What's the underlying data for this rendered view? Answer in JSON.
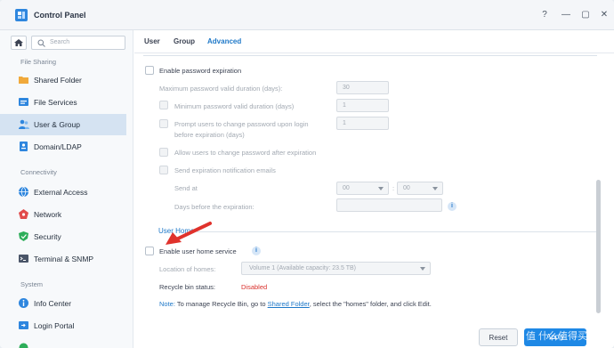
{
  "window": {
    "title": "Control Panel"
  },
  "sidebar": {
    "search_placeholder": "Search",
    "sections": [
      "File Sharing",
      "Connectivity",
      "System"
    ],
    "items": [
      {
        "label": "Shared Folder",
        "icon": "shared-folder-icon"
      },
      {
        "label": "File Services",
        "icon": "file-services-icon"
      },
      {
        "label": "User & Group",
        "icon": "user-group-icon",
        "active": true
      },
      {
        "label": "Domain/LDAP",
        "icon": "domain-icon"
      },
      {
        "label": "External Access",
        "icon": "external-access-icon"
      },
      {
        "label": "Network",
        "icon": "network-icon"
      },
      {
        "label": "Security",
        "icon": "security-icon"
      },
      {
        "label": "Terminal & SNMP",
        "icon": "terminal-icon"
      },
      {
        "label": "Info Center",
        "icon": "info-center-icon"
      },
      {
        "label": "Login Portal",
        "icon": "login-portal-icon"
      }
    ]
  },
  "tabs": [
    {
      "label": "User"
    },
    {
      "label": "Group"
    },
    {
      "label": "Advanced",
      "active": true
    }
  ],
  "password_expiration": {
    "enable_label": "Enable password expiration",
    "max_valid_label": "Maximum password valid duration (days):",
    "max_valid_value": "30",
    "min_valid_label": "Minimum password valid duration (days)",
    "min_valid_value": "1",
    "prompt_label_1": "Prompt users to change password upon login",
    "prompt_label_2": "before expiration (days)",
    "prompt_value": "1",
    "allow_change_label": "Allow users to change password after expiration",
    "send_notification_label": "Send expiration notification emails",
    "send_at_label": "Send at",
    "send_at_hour": "00",
    "send_at_minute": "00",
    "time_separator": ":",
    "days_before_label": "Days before the expiration:"
  },
  "user_home": {
    "section_title": "User Home",
    "enable_label": "Enable user home service",
    "location_label": "Location of homes:",
    "location_value": "Volume 1 (Available capacity:  23.5 TB)",
    "recycle_label": "Recycle bin status:",
    "recycle_status": "Disabled",
    "note_prefix": "Note:",
    "note_text_1": "To manage Recycle Bin, go to",
    "note_link": "Shared Folder",
    "note_text_2": ", select the \"homes\" folder, and click Edit."
  },
  "footer": {
    "reset_label": "Reset",
    "apply_label": "Apply"
  },
  "watermark": "值 什么值得买",
  "colors": {
    "accent": "#1e78c8",
    "disabled_red": "#d9302c",
    "apply_bg": "#1e88e5"
  }
}
